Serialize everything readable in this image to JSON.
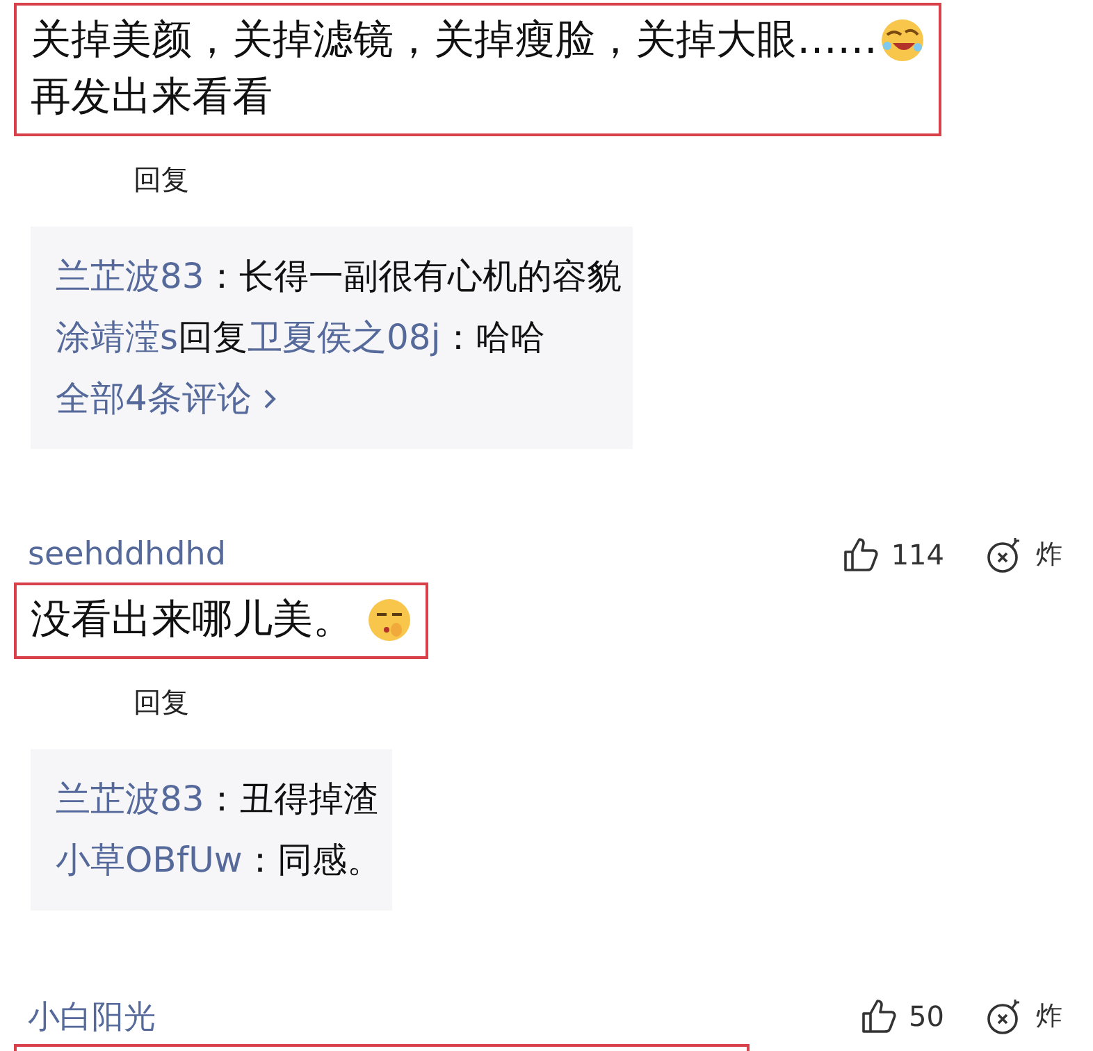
{
  "comments": [
    {
      "body": {
        "lines": [
          "关掉美颜，关掉滤镜，关掉瘦脸，关掉大眼……",
          "再发出来看看"
        ],
        "emoji": {
          "kind": "crying-laugh"
        },
        "highlighted": true
      },
      "reply_label": "回复",
      "replies": {
        "lines": [
          [
            {
              "kind": "user",
              "text": "兰芷波83"
            },
            {
              "kind": "plain",
              "text": "：长得一副很有心机的容貌"
            }
          ],
          [
            {
              "kind": "user",
              "text": "涂靖滢s"
            },
            {
              "kind": "plain",
              "text": "回复"
            },
            {
              "kind": "user",
              "text": "卫夏侯之08j"
            },
            {
              "kind": "plain",
              "text": "：哈哈"
            }
          ]
        ],
        "more": "全部4条评论"
      }
    },
    {
      "username": "seehddhdhd",
      "likes": "114",
      "bomb": "炸",
      "body": {
        "lines": [
          "没看出来哪儿美。"
        ],
        "emoji": {
          "kind": "shush"
        },
        "highlighted": true
      },
      "reply_label": "回复",
      "replies": {
        "lines": [
          [
            {
              "kind": "user",
              "text": "兰芷波83"
            },
            {
              "kind": "plain",
              "text": "：丑得掉渣"
            }
          ],
          [
            {
              "kind": "user",
              "text": "小草OBfUw"
            },
            {
              "kind": "plain",
              "text": "：同感。"
            }
          ]
        ]
      }
    },
    {
      "username": "小白阳光",
      "likes": "50",
      "bomb": "炸",
      "body": {
        "highlighted": true
      }
    }
  ]
}
